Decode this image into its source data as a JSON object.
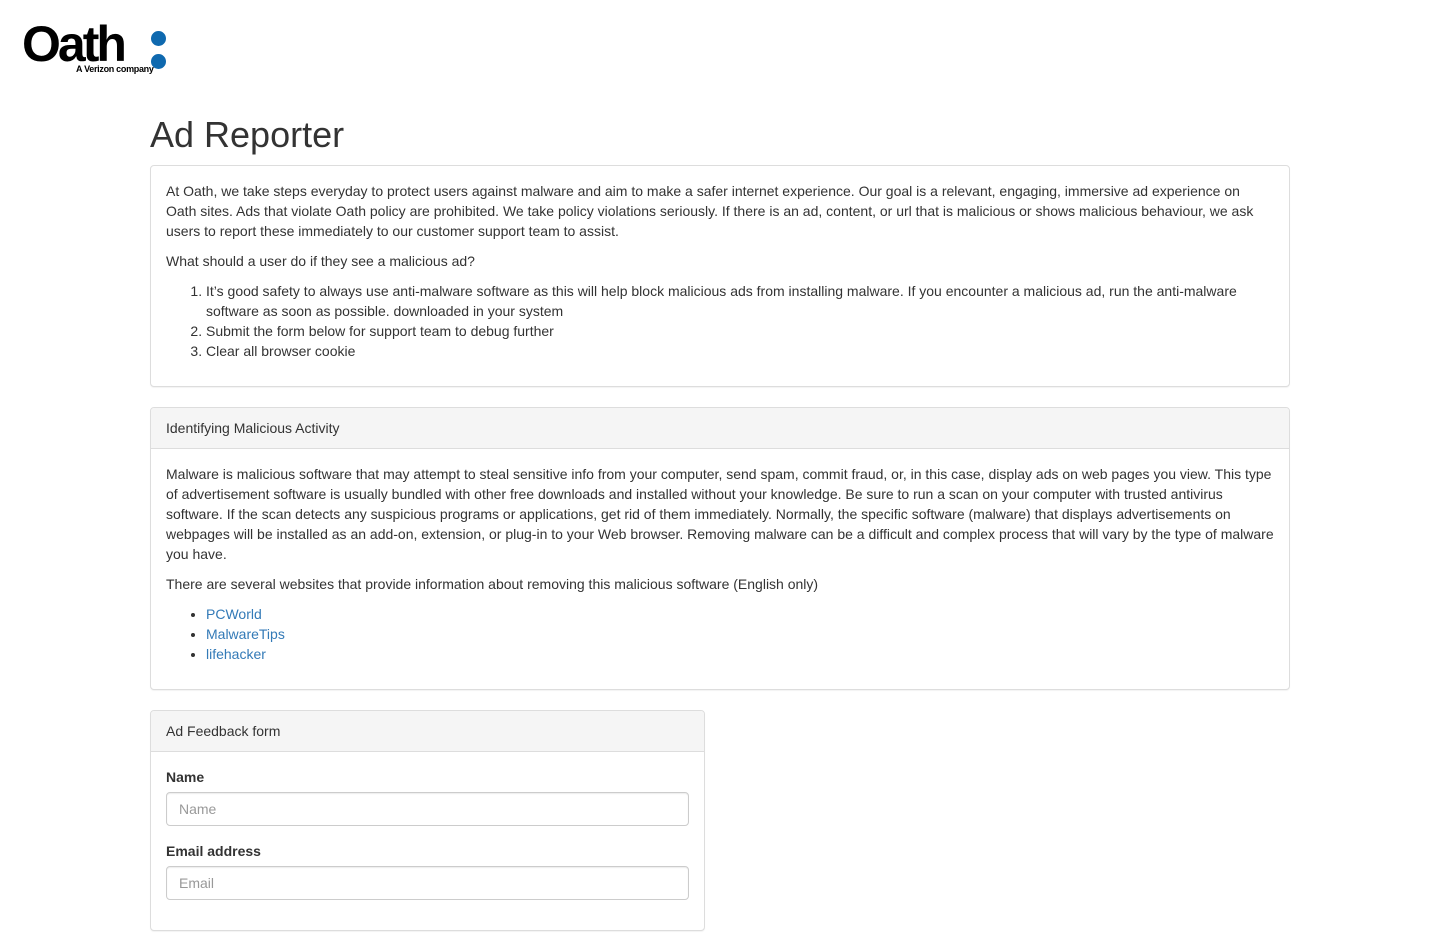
{
  "logo": {
    "word": "Oath",
    "tagline": "A Verizon company",
    "colon_color": "#0f69af"
  },
  "page_title": "Ad Reporter",
  "intro": {
    "paragraph": "At Oath, we take steps everyday to protect users against malware and aim to make a safer internet experience. Our goal is a relevant, engaging, immersive ad experience on Oath sites. Ads that violate Oath policy are prohibited. We take policy violations seriously. If there is an ad, content, or url that is malicious or shows malicious behaviour, we ask users to report these immediately to our customer support team to assist.",
    "question": "What should a user do if they see a malicious ad?",
    "steps": [
      "It’s good safety to always use anti-malware software as this will help block malicious ads from installing malware. If you encounter a malicious ad, run the anti-malware software as soon as possible. downloaded in your system",
      "Submit the form below for support team to debug further",
      "Clear all browser cookie"
    ]
  },
  "malicious": {
    "heading": "Identifying Malicious Activity",
    "paragraph": "Malware is malicious software that may attempt to steal sensitive info from your computer, send spam, commit fraud, or, in this case, display ads on web pages you view. This type of advertisement software is usually bundled with other free downloads and installed without your knowledge. Be sure to run a scan on your computer with trusted antivirus software. If the scan detects any suspicious programs or applications, get rid of them immediately. Normally, the specific software (malware) that displays advertisements on webpages will be installed as an add-on, extension, or plug-in to your Web browser. Removing malware can be a difficult and complex process that will vary by the type of malware you have.",
    "websites_intro": "There are several websites that provide information about removing this malicious software (English only)",
    "links": [
      "PCWorld",
      "MalwareTips",
      "lifehacker"
    ]
  },
  "form": {
    "heading": "Ad Feedback form",
    "name_label": "Name",
    "name_placeholder": "Name",
    "name_value": "",
    "email_label": "Email address",
    "email_placeholder": "Email",
    "email_value": ""
  },
  "colors": {
    "link": "#337ab7",
    "panel_heading_bg": "#f5f5f5",
    "border": "#dddddd"
  }
}
